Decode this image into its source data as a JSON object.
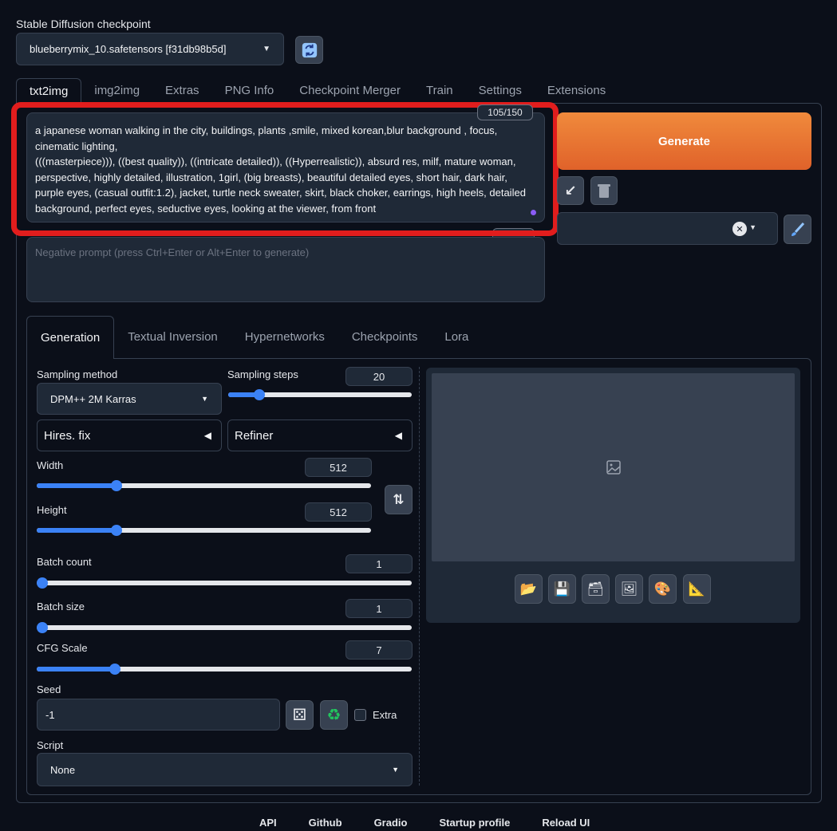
{
  "checkpoint": {
    "label": "Stable Diffusion checkpoint",
    "value": "blueberrymix_10.safetensors [f31db98b5d]",
    "refresh_icon": "refresh-icon"
  },
  "tabs": [
    "txt2img",
    "img2img",
    "Extras",
    "PNG Info",
    "Checkpoint Merger",
    "Train",
    "Settings",
    "Extensions"
  ],
  "prompt": {
    "token_count": "105/150",
    "text": "a japanese woman walking in the city, buildings, plants ,smile, mixed korean,blur background , focus, cinematic lighting,\n(((masterpiece))), ((best quality)), ((intricate detailed)), ((Hyperrealistic)), absurd res, milf, mature woman, perspective, highly detailed, illustration, 1girl, (big breasts), beautiful detailed eyes, short hair, dark hair, purple eyes, (casual outfit:1.2), jacket, turtle neck sweater, skirt, black choker, earrings, high heels, detailed background, perfect eyes, seductive eyes, looking at the viewer, from front",
    "negative_placeholder": "Negative prompt (press Ctrl+Enter or Alt+Enter to generate)"
  },
  "generate": {
    "label": "Generate"
  },
  "subtabs": [
    "Generation",
    "Textual Inversion",
    "Hypernetworks",
    "Checkpoints",
    "Lora"
  ],
  "generation": {
    "sampling_method": {
      "label": "Sampling method",
      "value": "DPM++ 2M Karras"
    },
    "sampling_steps": {
      "label": "Sampling steps",
      "value": "20",
      "fraction": 0.15
    },
    "hires_fix": "Hires. fix",
    "refiner": "Refiner",
    "width": {
      "label": "Width",
      "value": "512",
      "fraction": 0.23
    },
    "height": {
      "label": "Height",
      "value": "512",
      "fraction": 0.23
    },
    "batch_count": {
      "label": "Batch count",
      "value": "1",
      "fraction": 0
    },
    "batch_size": {
      "label": "Batch size",
      "value": "1",
      "fraction": 0
    },
    "cfg_scale": {
      "label": "CFG Scale",
      "value": "7",
      "fraction": 0.2
    },
    "seed": {
      "label": "Seed",
      "value": "-1",
      "extra_label": "Extra"
    },
    "script": {
      "label": "Script",
      "value": "None"
    }
  },
  "footer": [
    "API",
    "Github",
    "Gradio",
    "Startup profile",
    "Reload UI"
  ],
  "colors": {
    "accent": "#e0622a",
    "slider": "#3b82f6",
    "highlight": "#e11d1d"
  }
}
